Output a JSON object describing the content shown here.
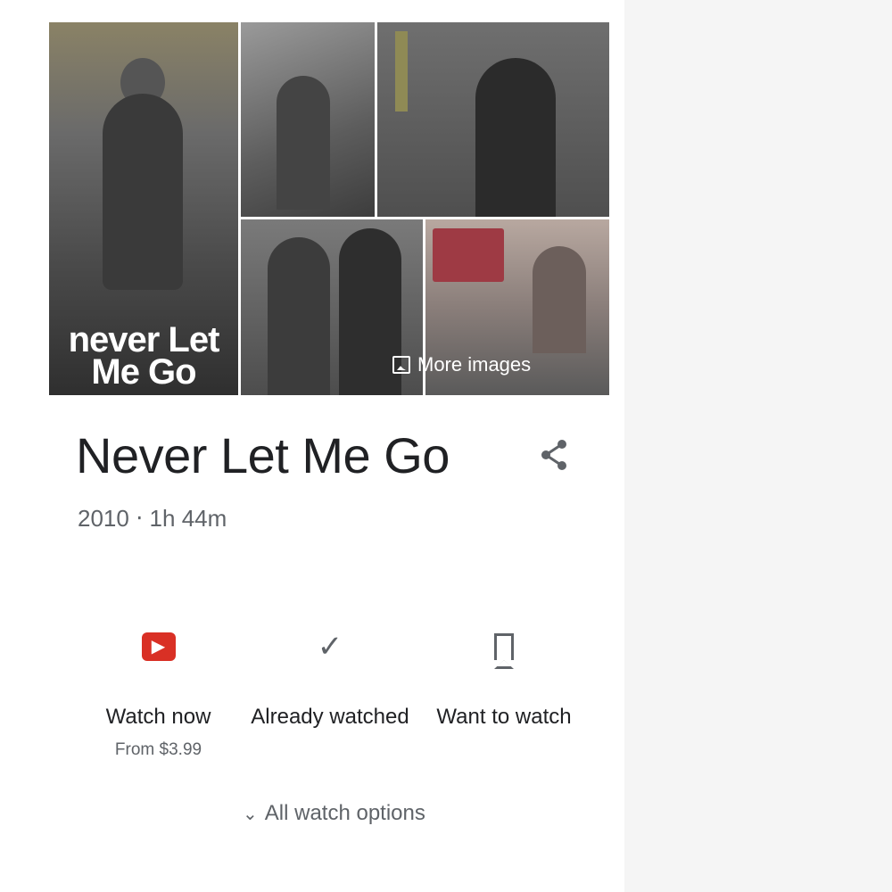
{
  "gallery": {
    "poster_title_line1": "never Let",
    "poster_title_line2": "Me Go",
    "more_images_label": "More images"
  },
  "movie": {
    "title": "Never Let Me Go",
    "meta": "2010 ‧ 1h 44m"
  },
  "actions": [
    {
      "label": "Watch now",
      "sub": "From $3.99",
      "icon": "play-badge-icon"
    },
    {
      "label": "Already watched",
      "icon": "check-icon"
    },
    {
      "label": "Want to watch",
      "icon": "bookmark-icon"
    }
  ],
  "all_options_label": "All watch options",
  "colors": {
    "accent_red": "#d93025",
    "text_primary": "#202124",
    "text_secondary": "#5f6368"
  }
}
